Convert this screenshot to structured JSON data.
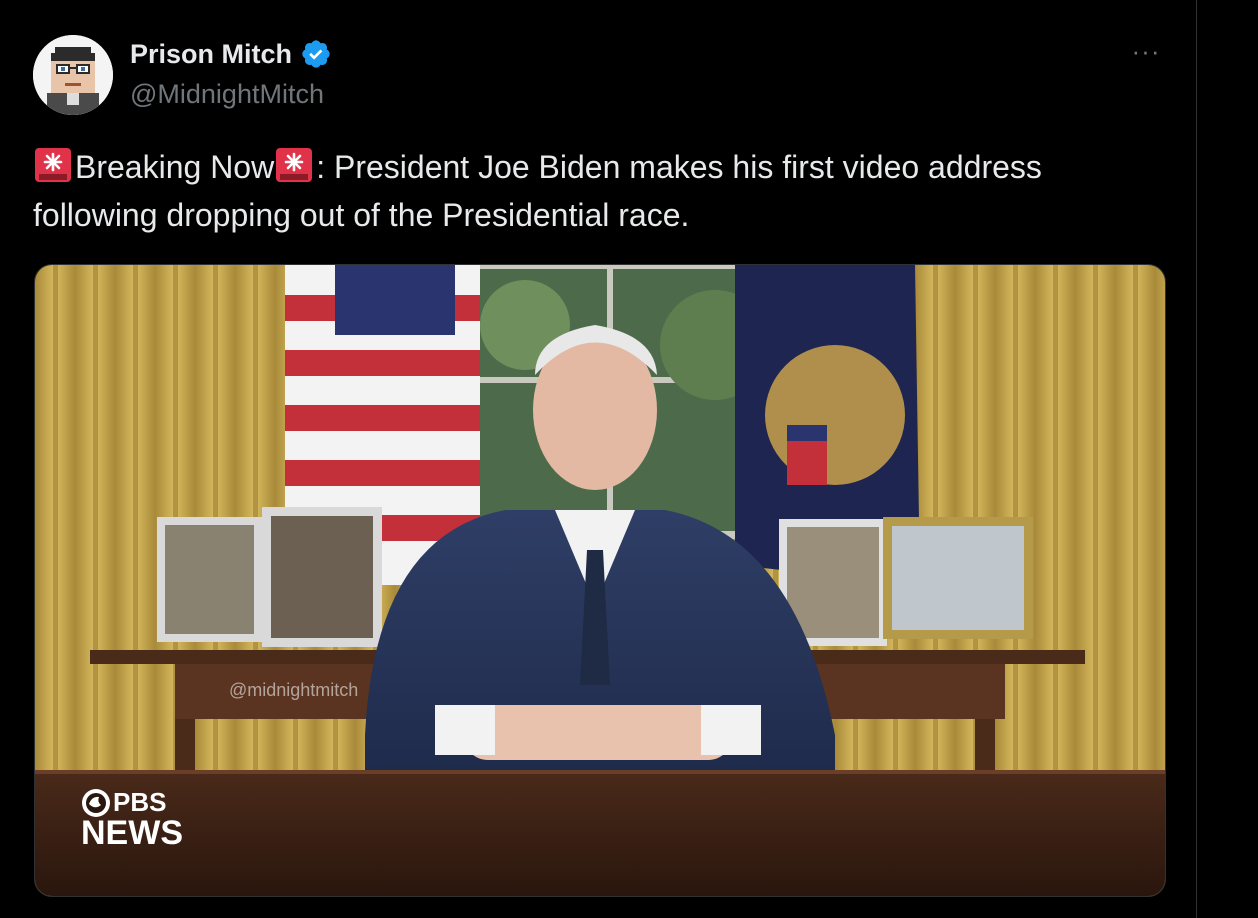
{
  "author": {
    "name": "Prison Mitch",
    "handle": "@MidnightMitch",
    "verified": true,
    "verified_color": "#1d9bf0"
  },
  "more_label": "···",
  "tweet": {
    "emoji_icon": "rotating-light-icon",
    "text_part1": "Breaking Now",
    "text_part2": ": President Joe Biden makes his first video address following dropping out of the Presidential race."
  },
  "media": {
    "watermark": "@midnightmitch",
    "logo_top": "PBS",
    "logo_bottom": "NEWS"
  },
  "colors": {
    "background": "#000000",
    "text": "#e7e9ea",
    "secondary_text": "#71767b"
  }
}
